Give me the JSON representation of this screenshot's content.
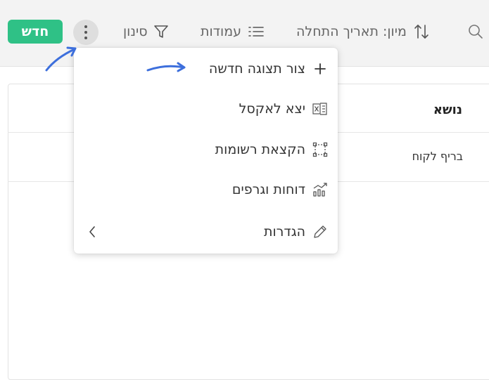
{
  "toolbar": {
    "new_label": "חדש",
    "filter_label": "סינון",
    "columns_label": "עמודות",
    "sort_label": "מיון: תאריך התחלה"
  },
  "table": {
    "header": "נושא",
    "rows": [
      "בריף לקוח"
    ]
  },
  "menu": {
    "items": [
      {
        "label": "צור תצוגה חדשה",
        "icon": "plus-icon"
      },
      {
        "label": "יצא לאקסל",
        "icon": "excel-export-icon"
      },
      {
        "label": "הקצאת רשומות",
        "icon": "select-records-icon"
      },
      {
        "label": "דוחות וגרפים",
        "icon": "chart-icon"
      },
      {
        "label": "הגדרות",
        "icon": "pencil-icon"
      }
    ]
  },
  "colors": {
    "accent_green": "#2fc186",
    "annotation_blue": "#3d6fdc"
  }
}
